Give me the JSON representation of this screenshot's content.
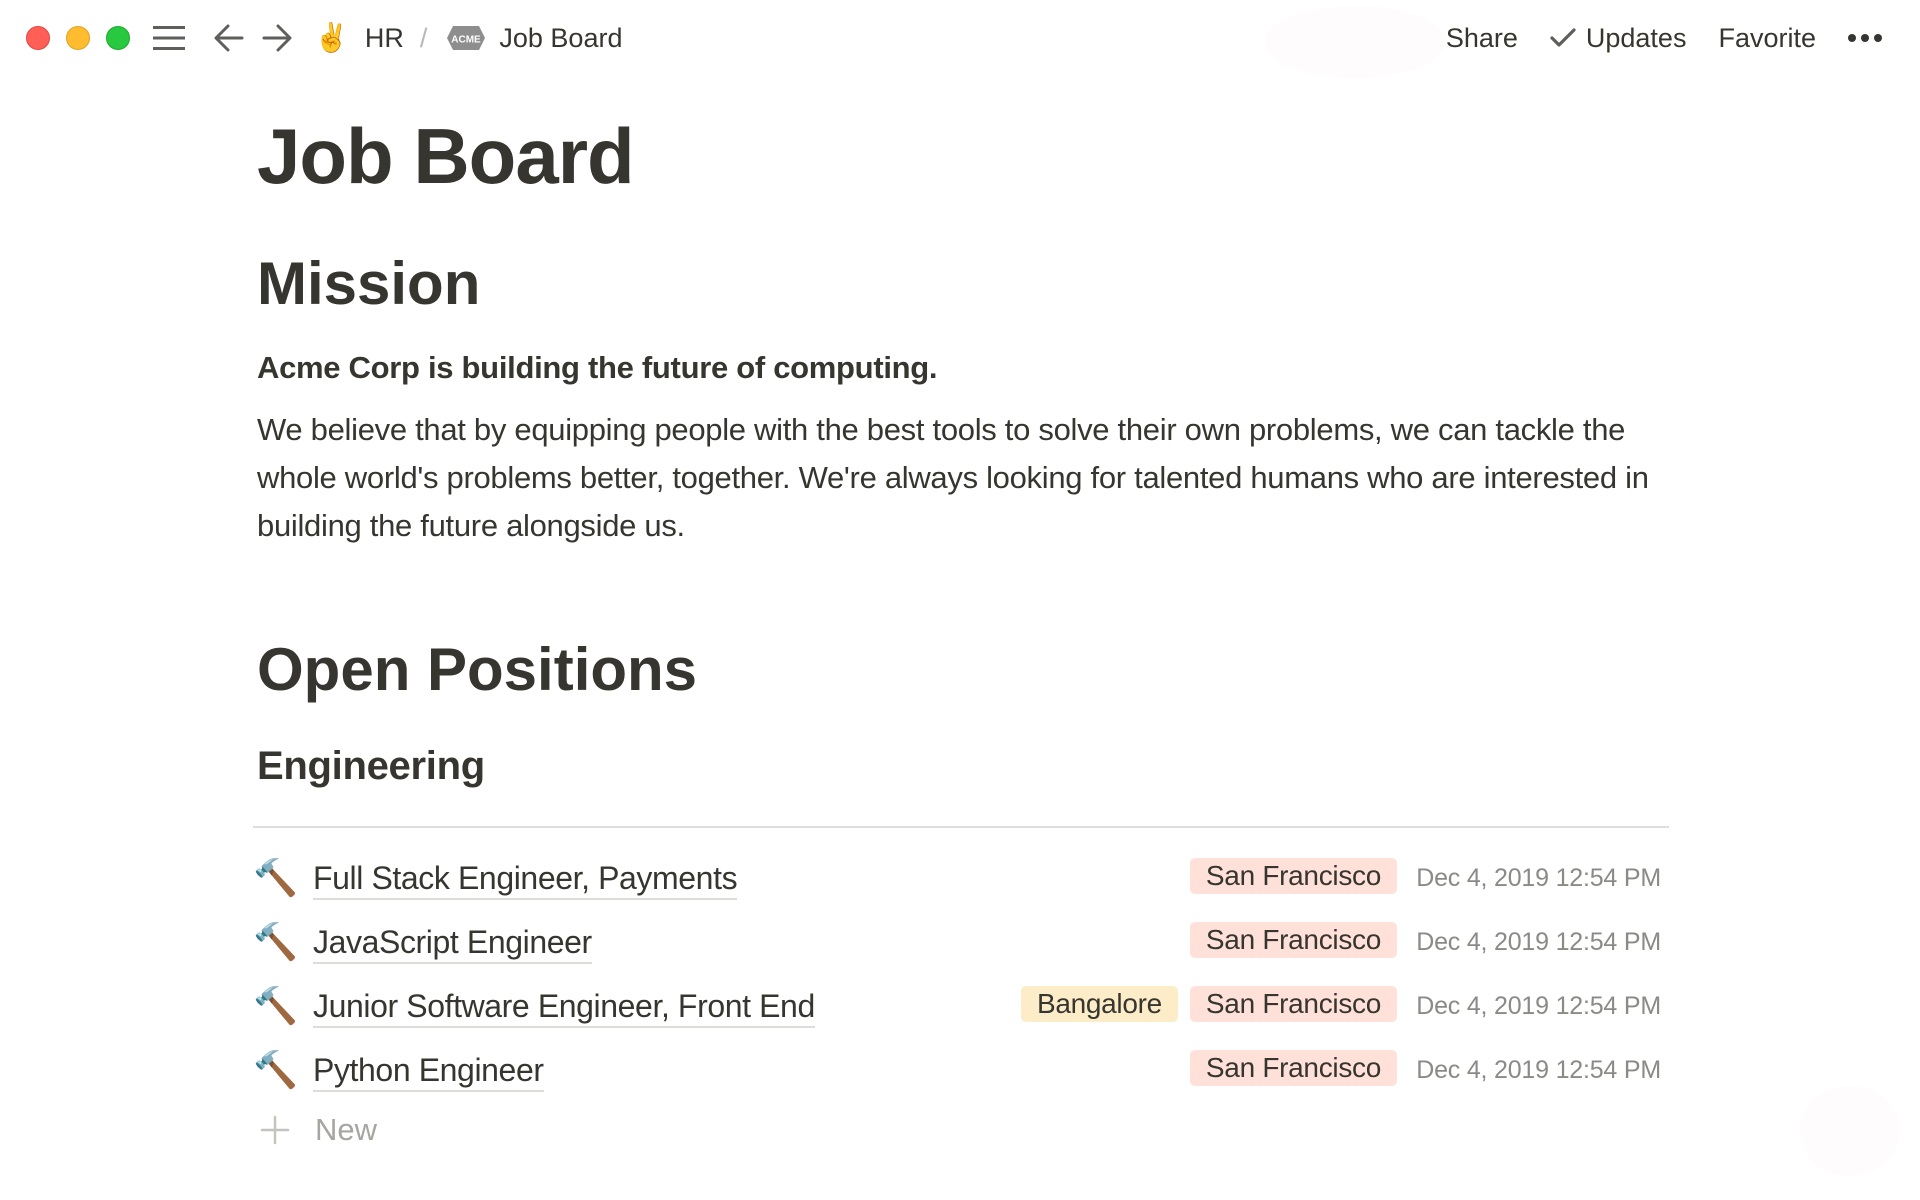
{
  "window": {
    "traffic_lights": {
      "close": "#ff5f57",
      "minimize": "#febc2e",
      "zoom": "#28c840"
    }
  },
  "topbar": {
    "menu_icon": "hamburger-icon",
    "back_icon": "arrow-left-icon",
    "forward_icon": "arrow-right-icon",
    "breadcrumb": [
      {
        "emoji": "✌️",
        "label": "HR"
      },
      {
        "icon": "acme-logo-icon",
        "icon_text": "ACME",
        "label": "Job Board"
      }
    ],
    "separator": "/",
    "actions": {
      "share": "Share",
      "updates": "Updates",
      "favorite": "Favorite",
      "more_icon": "more-horizontal-icon"
    }
  },
  "page": {
    "title": "Job Board",
    "mission": {
      "heading": "Mission",
      "lead": "Acme Corp is building the future of computing.",
      "body": "We believe that by equipping people with the best tools to solve their own problems, we can tackle the whole world's problems better, together. We're always looking for talented humans who are interested in building the future alongside us."
    },
    "open_positions": {
      "heading": "Open Positions",
      "groups": [
        {
          "name": "Engineering",
          "items": [
            {
              "icon": "🔨",
              "title": "Full Stack Engineer, Payments",
              "locations": [
                "San Francisco"
              ],
              "date": "Dec 4, 2019 12:54 PM"
            },
            {
              "icon": "🔨",
              "title": "JavaScript Engineer",
              "locations": [
                "San Francisco"
              ],
              "date": "Dec 4, 2019 12:54 PM"
            },
            {
              "icon": "🔨",
              "title": "Junior Software Engineer, Front End",
              "locations": [
                "Bangalore",
                "San Francisco"
              ],
              "date": "Dec 4, 2019 12:54 PM"
            },
            {
              "icon": "🔨",
              "title": "Python Engineer",
              "locations": [
                "San Francisco"
              ],
              "date": "Dec 4, 2019 12:54 PM"
            }
          ],
          "new_label": "New"
        }
      ]
    }
  },
  "tag_colors": {
    "San Francisco": "#ffe1d9",
    "Bangalore": "#fdecc8"
  }
}
